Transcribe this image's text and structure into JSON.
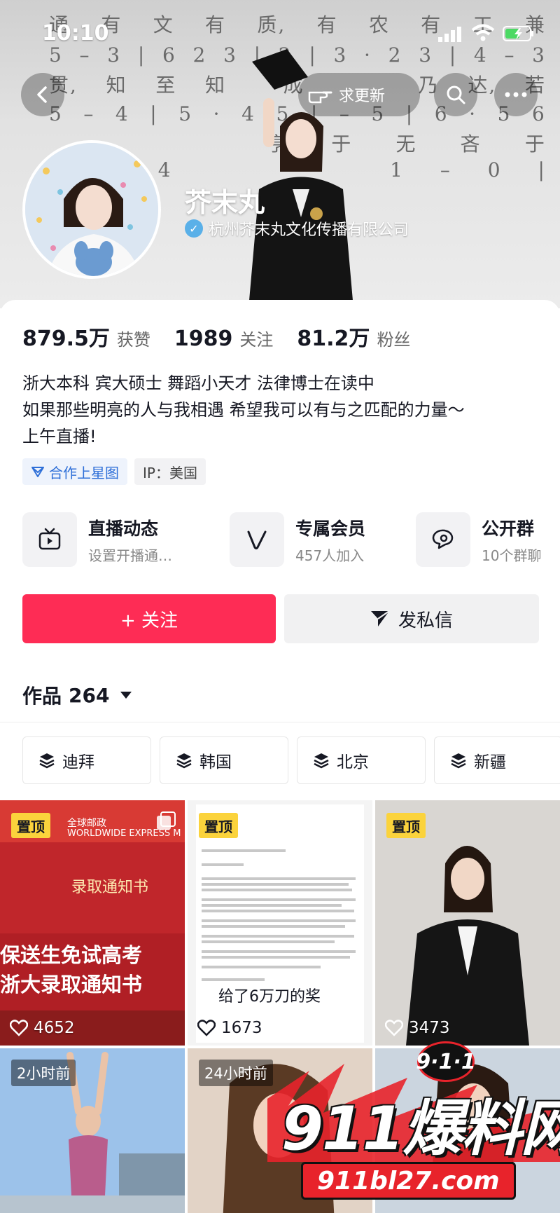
{
  "status_bar": {
    "time": "10:10"
  },
  "banner": {
    "score_lines": [
      [
        "通",
        "有",
        "文",
        "有",
        "质,",
        "有",
        "农",
        "有",
        "工",
        "兼"
      ],
      [
        "5",
        "–",
        "3",
        "|",
        "6",
        "2",
        "3",
        "|",
        "2",
        "|",
        "3",
        "·",
        "2",
        "3",
        "|",
        "4",
        "–",
        "3"
      ],
      [
        "贯,",
        "知",
        "至",
        "知",
        "",
        "成",
        "",
        "",
        "",
        "乃",
        "达,",
        "若"
      ],
      [
        "5",
        "–",
        "4",
        "|",
        "5",
        "·",
        "4",
        "5",
        "|",
        "–",
        "5",
        "|",
        "6",
        "·",
        "5",
        "6"
      ],
      [
        "",
        "",
        "",
        "",
        "",
        "亨",
        "于",
        "无",
        "吝",
        "于"
      ],
      [
        "",
        "",
        "",
        "4",
        "",
        "",
        "",
        "",
        "",
        "1",
        "–",
        "0",
        "|"
      ]
    ],
    "request_update_label": "求更新",
    "name": "芥末丸",
    "verified_org": "杭州芥末丸文化传播有限公司"
  },
  "stats": [
    {
      "num": "879.5万",
      "label": "获赞"
    },
    {
      "num": "1989",
      "label": "关注"
    },
    {
      "num": "81.2万",
      "label": "粉丝"
    }
  ],
  "bio": [
    "浙大本科 宾大硕士 舞蹈小天才 法律博士在读中",
    "如果那些明亮的人与我相遇 希望我可以有与之匹配的力量～",
    "上午直播!"
  ],
  "tags": {
    "star_map": "合作上星图",
    "ip": "IP：美国"
  },
  "shortcuts": [
    {
      "title": "直播动态",
      "sub": "设置开播通…",
      "icon": "tv-icon"
    },
    {
      "title": "专属会员",
      "sub": "457人加入",
      "icon": "v-member-icon"
    },
    {
      "title": "公开群",
      "sub": "10个群聊",
      "icon": "chat-group-icon"
    }
  ],
  "actions": {
    "follow": "+ 关注",
    "message": "发私信"
  },
  "works": {
    "label": "作品",
    "count": "264"
  },
  "chips": [
    "迪拜",
    "韩国",
    "北京",
    "新疆"
  ],
  "videos": [
    {
      "pinned": "置顶",
      "likes": "4652",
      "texts": [
        "全球邮政",
        "WORLDWIDE EXPRESS M",
        "录取通知书",
        "保送生免试高考",
        "浙大录取通知书"
      ]
    },
    {
      "pinned": "置顶",
      "likes": "1673",
      "caption": "给了6万刀的奖"
    },
    {
      "pinned": "置顶",
      "likes": "3473"
    },
    {
      "ago": "2小时前"
    },
    {
      "ago": "24小时前"
    },
    {
      "watermark": {
        "badge": "9·1·1",
        "main": "911爆料网",
        "url": "911bl27.com"
      }
    }
  ],
  "colors": {
    "primary": "#fe2c55",
    "pin": "#fbd33c",
    "link_blue": "#2e6fd8"
  }
}
